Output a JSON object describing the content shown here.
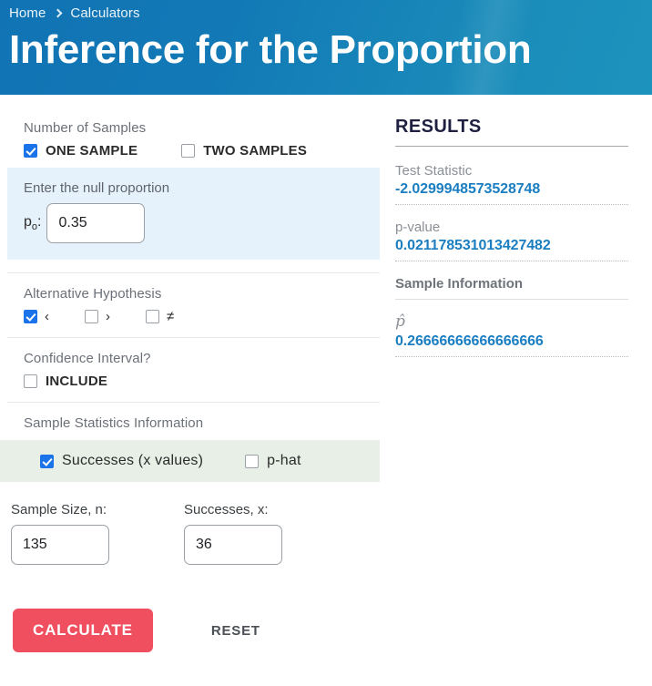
{
  "header": {
    "breadcrumb": {
      "home": "Home",
      "current": "Calculators",
      "separator_icon": "chevron-right-icon"
    },
    "title": "Inference for the Proportion",
    "gradient_from": "#1173b4",
    "gradient_to": "#1c93bd"
  },
  "form": {
    "number_of_samples": {
      "label": "Number of Samples",
      "options": [
        {
          "label": "ONE SAMPLE",
          "checked": true
        },
        {
          "label": "TWO SAMPLES",
          "checked": false
        }
      ]
    },
    "null_proportion": {
      "hint": "Enter the null proportion",
      "field_label": "p",
      "field_subscript": "o",
      "field_colon": ":",
      "value": "0.35",
      "background": "#e6f2fb"
    },
    "alternative_hypothesis": {
      "label": "Alternative Hypothesis",
      "options": [
        {
          "symbol": "‹",
          "checked": true
        },
        {
          "symbol": "›",
          "checked": false
        },
        {
          "symbol": "≠",
          "checked": false
        }
      ]
    },
    "confidence_interval": {
      "label": "Confidence Interval?",
      "options": [
        {
          "label": "INCLUDE",
          "checked": false
        }
      ]
    },
    "sample_statistics": {
      "label": "Sample Statistics Information",
      "background": "#e7efe7",
      "options": [
        {
          "label": "Successes (x values)",
          "checked": true
        },
        {
          "label": "p-hat",
          "checked": false
        }
      ],
      "fields": [
        {
          "label": "Sample Size, n:",
          "value": "135"
        },
        {
          "label": "Successes, x:",
          "value": "36"
        }
      ]
    },
    "actions": {
      "calculate_label": "CALCULATE",
      "calculate_color": "#ef4f5f",
      "reset_label": "RESET"
    }
  },
  "results": {
    "title": "RESULTS",
    "value_color": "#1b7ec0",
    "items": [
      {
        "key": "Test Statistic",
        "value": "-2.0299948573528748"
      },
      {
        "key": "p-value",
        "value": "0.021178531013427482"
      }
    ],
    "sample_information": {
      "title": "Sample Information",
      "items": [
        {
          "key": "p̂",
          "value": "0.26666666666666666"
        }
      ]
    }
  }
}
